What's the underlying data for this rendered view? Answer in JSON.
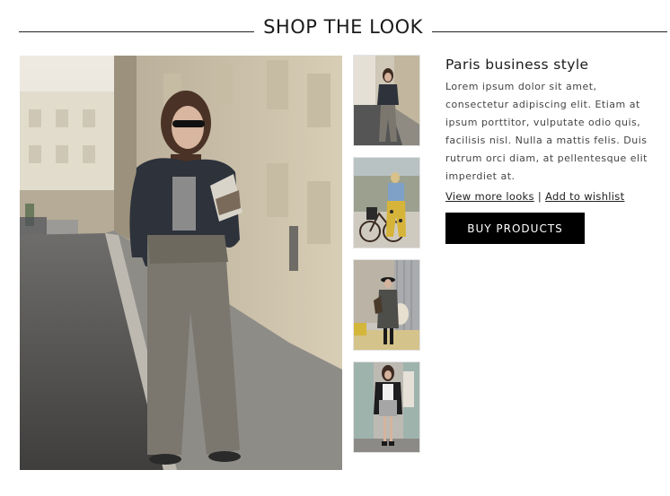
{
  "header": {
    "title": "SHOP THE LOOK"
  },
  "look": {
    "title": "Paris business style",
    "description": "Lorem ipsum dolor sit amet, consectetur adipiscing elit. Etiam at ipsum porttitor, vulputate odio quis, facilisis nisl. Nulla a mattis felis. Duis rutrum orci diam, at pellentesque elit imperdiet at."
  },
  "links": {
    "view_more": "View more looks",
    "separator": "|",
    "wishlist": "Add to wishlist"
  },
  "button": {
    "buy_label": "BUY PRODUCTS"
  },
  "colors": {
    "button_bg": "#000000",
    "button_text": "#ffffff",
    "rule": "#222222"
  },
  "thumbnails": [
    {
      "name": "look-thumbnail-1"
    },
    {
      "name": "look-thumbnail-2"
    },
    {
      "name": "look-thumbnail-3"
    },
    {
      "name": "look-thumbnail-4"
    }
  ]
}
